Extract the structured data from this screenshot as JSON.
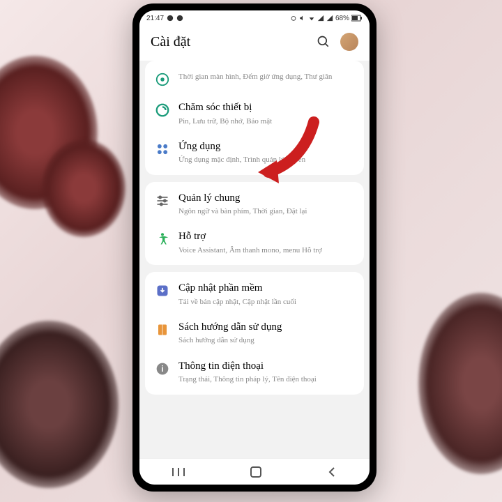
{
  "status": {
    "time": "21:47",
    "battery": "68%"
  },
  "header": {
    "title": "Cài đặt"
  },
  "sections": [
    {
      "items": [
        {
          "icon": "wellbeing",
          "title": "",
          "sub": "Thời gian màn hình, Đếm giờ ứng dụng, Thư giãn"
        },
        {
          "icon": "device-care",
          "title": "Chăm sóc thiết bị",
          "sub": "Pin, Lưu trữ, Bộ nhớ, Bảo mật"
        },
        {
          "icon": "apps",
          "title": "Ứng dụng",
          "sub": "Ứng dụng mặc định, Trình quản lý quyền"
        }
      ]
    },
    {
      "items": [
        {
          "icon": "general",
          "title": "Quản lý chung",
          "sub": "Ngôn ngữ và bàn phím, Thời gian, Đặt lại"
        },
        {
          "icon": "accessibility",
          "title": "Hỗ trợ",
          "sub": "Voice Assistant, Âm thanh mono, menu Hỗ trợ"
        }
      ]
    },
    {
      "items": [
        {
          "icon": "update",
          "title": "Cập nhật phần mềm",
          "sub": "Tải về bản cập nhật, Cập nhật lần cuối"
        },
        {
          "icon": "manual",
          "title": "Sách hướng dẫn sử dụng",
          "sub": "Sách hướng dẫn sử dụng"
        },
        {
          "icon": "about",
          "title": "Thông tin điện thoại",
          "sub": "Trạng thái, Thông tin pháp lý, Tên điện thoại"
        }
      ]
    }
  ],
  "annotation": {
    "target": "apps-item",
    "color": "#cc1f1f"
  }
}
